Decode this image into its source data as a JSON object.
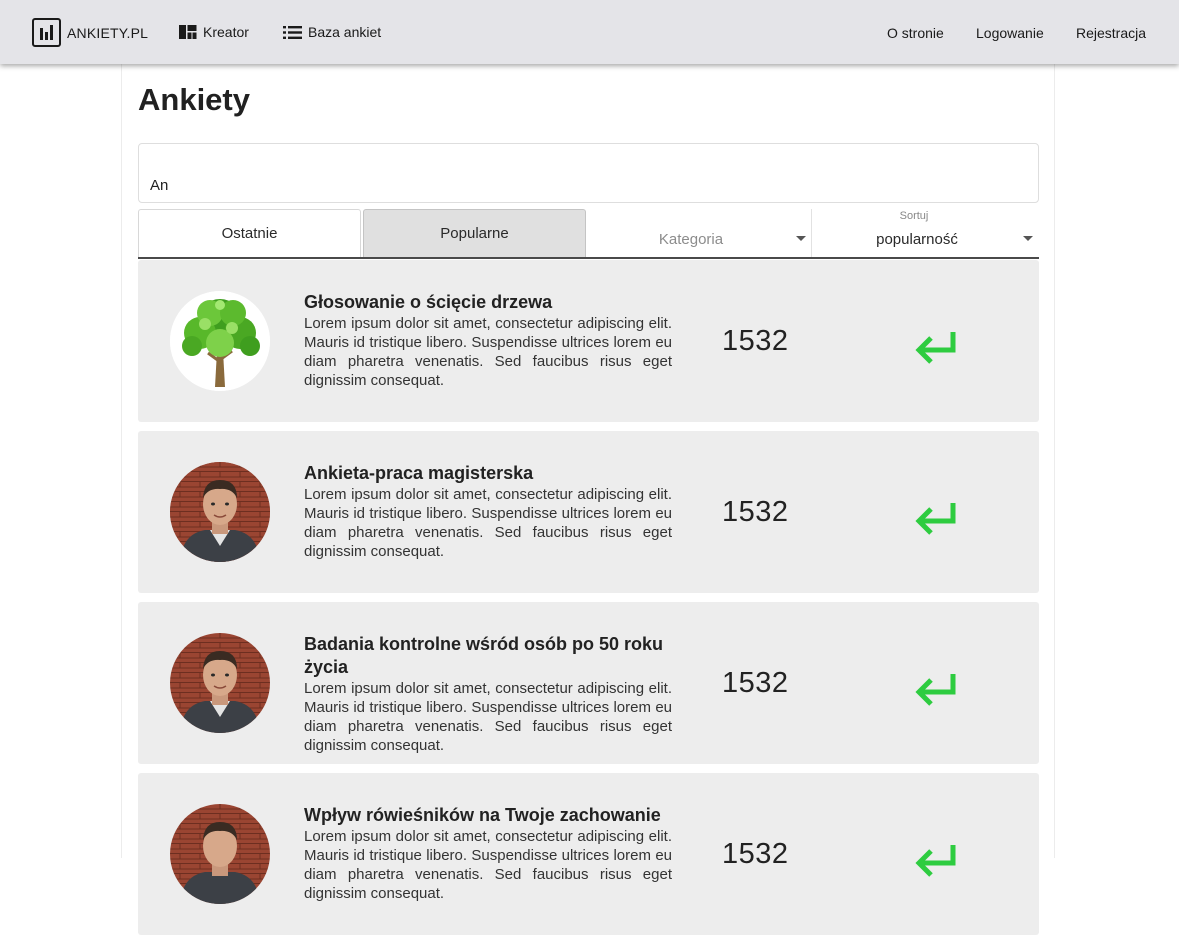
{
  "nav": {
    "brand": "ANKIETY.PL",
    "kreator": "Kreator",
    "baza": "Baza ankiet",
    "o_stronie": "O stronie",
    "logowanie": "Logowanie",
    "rejestracja": "Rejestracja"
  },
  "page": {
    "title": "Ankiety"
  },
  "search": {
    "value": "An"
  },
  "filters": {
    "recent": "Ostatnie",
    "popular": "Popularne",
    "category_placeholder": "Kategoria",
    "sort_label": "Sortuj",
    "sort_value": "popularność"
  },
  "surveys": [
    {
      "title": "Głosowanie o ścięcie drzewa",
      "description": "Lorem ipsum dolor sit amet, consectetur adipiscing elit. Mauris id tristique libero. Suspendisse ultrices lorem eu diam pharetra venenatis. Sed faucibus risus eget dignissim consequat.",
      "count": "1532",
      "image": "tree-image"
    },
    {
      "title": "Ankieta-praca magisterska",
      "description": "Lorem ipsum dolor sit amet, consectetur adipiscing elit. Mauris id tristique libero. Suspendisse ultrices lorem eu diam pharetra venenatis. Sed faucibus risus eget dignissim consequat.",
      "count": "1532",
      "image": "person-photo"
    },
    {
      "title": "Badania kontrolne wśród osób po 50 roku życia",
      "description": "Lorem ipsum dolor sit amet, consectetur adipiscing elit. Mauris id tristique libero. Suspendisse ultrices lorem eu diam pharetra venenatis. Sed faucibus risus eget dignissim consequat.",
      "count": "1532",
      "image": "person-photo"
    },
    {
      "title": "Wpływ rówieśników na Twoje zachowanie",
      "description": "Lorem ipsum dolor sit amet, consectetur adipiscing elit. Mauris id tristique libero. Suspendisse ultrices lorem eu diam pharetra venenatis. Sed faucibus risus eget dignissim consequat.",
      "count": "1532",
      "image": "person-photo"
    }
  ],
  "colors": {
    "accent_green": "#2ecc40",
    "navbar": "#e4e4e8",
    "card": "#ededed"
  },
  "icons": {
    "brand": "bar-chart-icon",
    "kreator": "dashboard-icon",
    "baza": "list-icon",
    "go": "enter-arrow-icon"
  }
}
